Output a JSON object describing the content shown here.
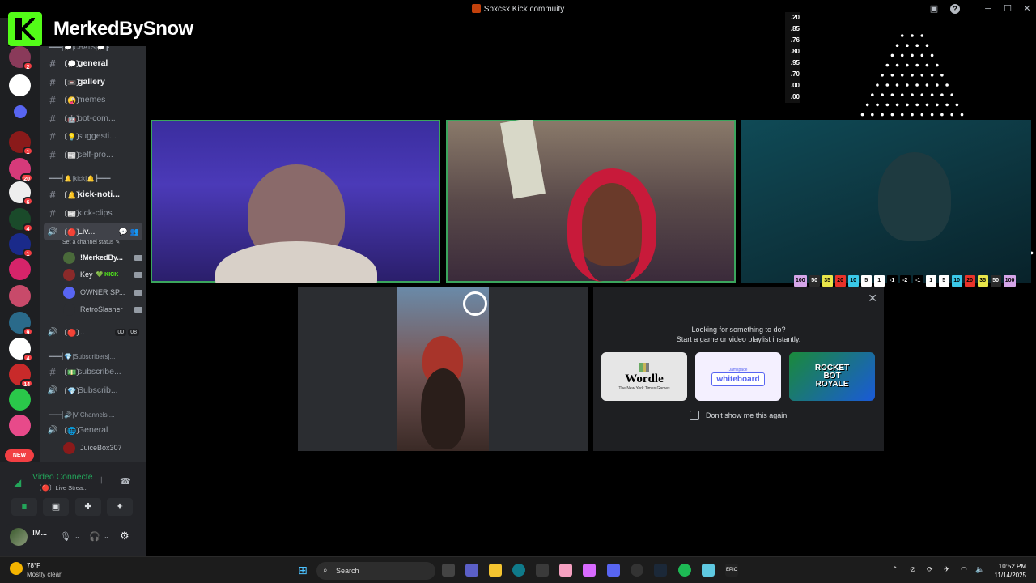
{
  "window": {
    "title": "Spxcsx Kick commuity",
    "minimize": "─",
    "maximize": "☐",
    "close": "✕",
    "help": "?"
  },
  "overlay": {
    "brand_name": "MerkedBySnow",
    "plinko_numbers": [
      ".20",
      ".85",
      ".76",
      ".80",
      ".95",
      ".70",
      ".00",
      ".00"
    ],
    "plinko_slots": [
      {
        "label": "100",
        "color": "#d4a5e8"
      },
      {
        "label": "50",
        "color": "#2a2a2a",
        "text": "#fff"
      },
      {
        "label": "35",
        "color": "#e8e64a"
      },
      {
        "label": "20",
        "color": "#e8332a"
      },
      {
        "label": "10",
        "color": "#3ac8e8"
      },
      {
        "label": "5",
        "color": "#ffffff"
      },
      {
        "label": "1",
        "color": "#ffffff"
      },
      {
        "label": "-1",
        "color": "#000000",
        "text": "#fff"
      },
      {
        "label": "-2",
        "color": "#000000",
        "text": "#fff"
      },
      {
        "label": "-1",
        "color": "#000000",
        "text": "#fff"
      },
      {
        "label": "1",
        "color": "#ffffff"
      },
      {
        "label": "5",
        "color": "#ffffff"
      },
      {
        "label": "10",
        "color": "#3ac8e8"
      },
      {
        "label": "20",
        "color": "#e8332a"
      },
      {
        "label": "35",
        "color": "#e8e64a"
      },
      {
        "label": "50",
        "color": "#2a2a2a",
        "text": "#fff"
      },
      {
        "label": "100",
        "color": "#d4a5e8"
      }
    ]
  },
  "servers": [
    {
      "badge": "2",
      "color": "#8a3a5a"
    },
    {
      "badge": "",
      "color": "#ffffff"
    },
    {
      "badge": "",
      "color": "#5865f2"
    },
    {
      "badge": "1",
      "color": "#8a1a1a"
    },
    {
      "badge": "20",
      "color": "#d63a7a"
    },
    {
      "badge": "6",
      "color": "#eeeeee"
    },
    {
      "badge": "4",
      "color": "#1a4a2a"
    },
    {
      "badge": "1",
      "color": "#1a2a8a"
    },
    {
      "badge": "",
      "color": "#d6246a"
    },
    {
      "badge": "",
      "color": "#c84a6a"
    },
    {
      "badge": "9",
      "color": "#2a6a8a"
    },
    {
      "badge": "4",
      "color": "#ffffff"
    },
    {
      "badge": "14",
      "color": "#c82a2a"
    },
    {
      "badge": "",
      "color": "#2ac84a"
    },
    {
      "badge": "",
      "color": "#e84a8a"
    }
  ],
  "new_badge": "NEW",
  "channels": {
    "cat_chats": "━━━┫💭|CHATS|💭┣...",
    "cat_kick": "━━━┫🔔|kick|🔔┣━━━",
    "cat_subs": "━━━┫💎|Subscribers|...",
    "cat_vc": "━━━┫🔊|V Channels|...",
    "items": [
      {
        "emoji": "〔💭〕",
        "name": "general"
      },
      {
        "emoji": "〔📼〕",
        "name": "gallery"
      },
      {
        "emoji": "〔🤪〕",
        "name": "memes"
      },
      {
        "emoji": "〔🤖〕",
        "name": "bot-com..."
      },
      {
        "emoji": "〔💡〕",
        "name": "suggesti..."
      },
      {
        "emoji": "〔📰〕",
        "name": "self-pro..."
      },
      {
        "emoji": "〔🔔〕",
        "name": "kick-noti..."
      },
      {
        "emoji": "〔📰〕",
        "name": "kick-clips"
      },
      {
        "emoji": "〔🔴〕",
        "name": "Liv..."
      },
      {
        "emoji": "〔🔴〕",
        "name": "..."
      },
      {
        "emoji": "〔💵〕",
        "name": "subscribe..."
      },
      {
        "emoji": "〔💎〕",
        "name": "Subscrib..."
      },
      {
        "emoji": "〔🌐〕",
        "name": "General"
      }
    ],
    "set_status": "Set a channel status ✎",
    "voice_users": [
      {
        "name": "!MerkedBy...",
        "color": "#4a6a3a"
      },
      {
        "name": "Key",
        "color": "#8a2a2a",
        "tag": "💚 KICK"
      },
      {
        "name": "OWNER SP...",
        "color": "#5865f2"
      },
      {
        "name": "RetroSlasher",
        "color": "#2b2d31"
      }
    ],
    "other_voice_counts": [
      "00",
      "08"
    ],
    "general_user": "JuiceBox307"
  },
  "voice_panel": {
    "status": "Video Connecte",
    "sub": "〔🔴〕Live Strea...",
    "username": "!M..."
  },
  "activity": {
    "title": "Looking for something to do?",
    "subtitle": "Start a game or video playlist instantly.",
    "cards": [
      {
        "name": "Wordle",
        "caption": "The New York Times Games"
      },
      {
        "name": "whiteboard",
        "caption": "Jamspace"
      },
      {
        "name": "ROCKET BOT ROYALE",
        "caption": ""
      }
    ],
    "dont_show": "Don't show me this again."
  },
  "taskbar": {
    "temp": "78°F",
    "condition": "Mostly clear",
    "search": "Search",
    "time": "10:52 PM",
    "date": "11/14/2025"
  }
}
